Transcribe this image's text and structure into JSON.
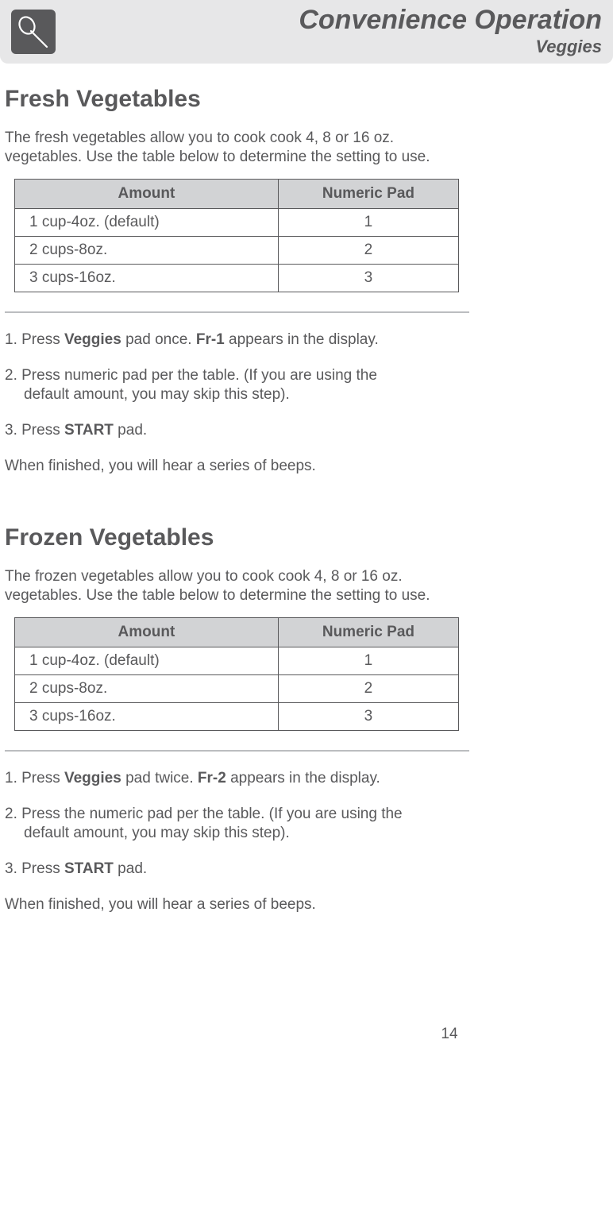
{
  "header": {
    "title": "Convenience Operation",
    "subtitle": "Veggies",
    "icon": "microwave-veggie-icon"
  },
  "sections": [
    {
      "heading": "Fresh Vegetables",
      "intro": "The fresh vegetables allow you to cook cook 4, 8 or 16 oz. vegetables. Use the table below to determine the setting to use.",
      "table": {
        "headers": [
          "Amount",
          "Numeric Pad"
        ],
        "rows": [
          [
            "1 cup-4oz. (default)",
            "1"
          ],
          [
            "2 cups-8oz.",
            "2"
          ],
          [
            "3 cups-16oz.",
            "3"
          ]
        ]
      },
      "steps": [
        {
          "prefix": "1. Press ",
          "bold1": "Veggies",
          "mid": " pad once. ",
          "bold2": "Fr-1",
          "suffix": " appears in the display."
        },
        {
          "prefix": "2. Press numeric pad per the table. (If you are using the",
          "cont": "default amount, you may skip this step)."
        },
        {
          "prefix": "3. Press ",
          "bold1": "START",
          "suffix": " pad."
        }
      ],
      "note": "When finished, you will hear a series of beeps."
    },
    {
      "heading": "Frozen Vegetables",
      "intro": "The frozen vegetables allow you to cook cook 4, 8 or 16 oz. vegetables. Use the table below to determine the setting to use.",
      "table": {
        "headers": [
          "Amount",
          "Numeric Pad"
        ],
        "rows": [
          [
            "1 cup-4oz. (default)",
            "1"
          ],
          [
            "2 cups-8oz.",
            "2"
          ],
          [
            "3 cups-16oz.",
            "3"
          ]
        ]
      },
      "steps": [
        {
          "prefix": "1. Press ",
          "bold1": "Veggies",
          "mid": " pad twice. ",
          "bold2": "Fr-2",
          "suffix": " appears in the display."
        },
        {
          "prefix": "2. Press the numeric pad per the table. (If you are using the",
          "cont": "default amount, you may skip this step)."
        },
        {
          "prefix": "3. Press ",
          "bold1": "START",
          "suffix": " pad."
        }
      ],
      "note": "When finished, you will hear a series of beeps."
    }
  ],
  "page_number": "14"
}
